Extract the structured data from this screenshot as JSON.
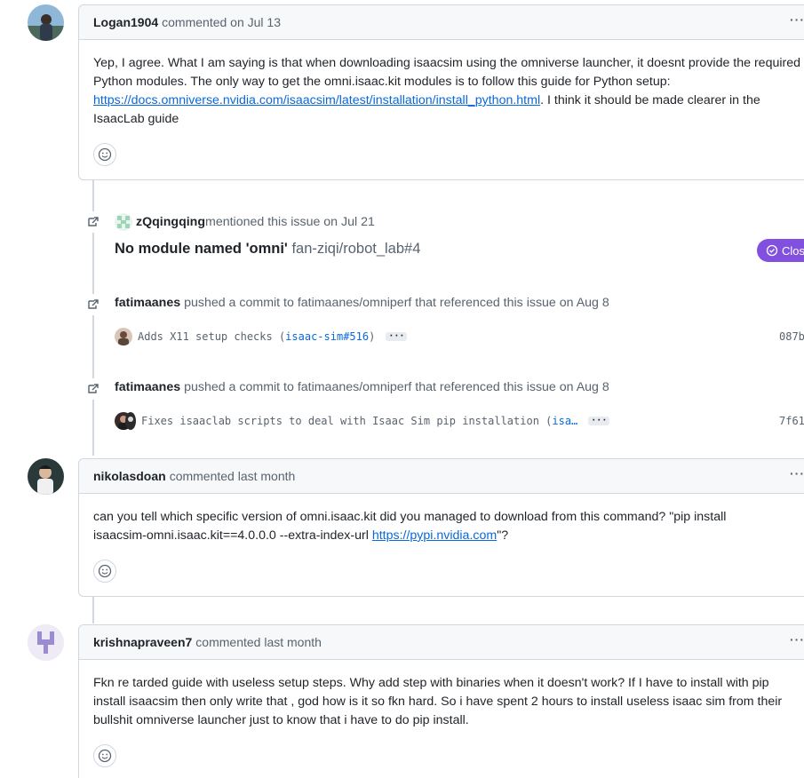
{
  "comments": [
    {
      "author": "Logan1904",
      "meta": "commented on Jul 13",
      "menu": "···",
      "body_parts": {
        "p1": "Yep, I agree. What I am saying is that when downloading isaacsim using the omniverse launcher, it doesnt provide the required Python modules. The only way to get the omni.isaac.kit modules is to follow this guide for Python setup: ",
        "link": "https://docs.omniverse.nvidia.com/isaacsim/latest/installation/install_python.html",
        "p2": ". I think it should be made clearer in the IsaacLab guide"
      }
    },
    {
      "author": "nikolasdoan",
      "meta": "commented last month",
      "menu": "···",
      "body_parts": {
        "p1": "can you tell which specific version of omni.isaac.kit did you managed to download from this command? \"pip install isaacsim-omni.isaac.kit==4.0.0.0 --extra-index-url ",
        "link": "https://pypi.nvidia.com",
        "p2": "\"?"
      }
    },
    {
      "author": "krishnapraveen7",
      "meta": "commented last month",
      "menu": "···",
      "body_parts": {
        "p1": "Fkn re tarded guide with useless setup steps. Why add step with binaries when it doesn't work? If I have to install with pip install isaacsim then only write that , god how is it so fkn hard. So i have spent 2 hours to install useless isaac sim from their bullshit omniverse launcher just to know that i have to do pip install."
      }
    }
  ],
  "mention_event": {
    "who": "zQqingqing",
    "text": " mentioned this issue on Jul 21",
    "ref_title": "No module named 'omni'",
    "ref_repo": "fan-ziqi/robot_lab#4",
    "status": "Closed"
  },
  "commit_events": [
    {
      "who": "fatimaanes",
      "text": " pushed a commit to fatimaanes/omniperf that referenced this issue on Aug 8",
      "commit_msg": "Adds X11 setup checks (",
      "commit_ref": "isaac-sim#516",
      "commit_tail": ")",
      "more": "···",
      "sha": "087b"
    },
    {
      "who": "fatimaanes",
      "text": " pushed a commit to fatimaanes/omniperf that referenced this issue on Aug 8",
      "commit_msg": "Fixes isaaclab scripts to deal with Isaac Sim pip installation (",
      "commit_ref": "isa…",
      "commit_tail": "",
      "more": "···",
      "sha": "7f61"
    }
  ],
  "colors": {
    "accent_link": "#0969da",
    "closed_purple": "#8250df",
    "border": "#d0d7de",
    "header_bg": "#f6f8fa"
  }
}
